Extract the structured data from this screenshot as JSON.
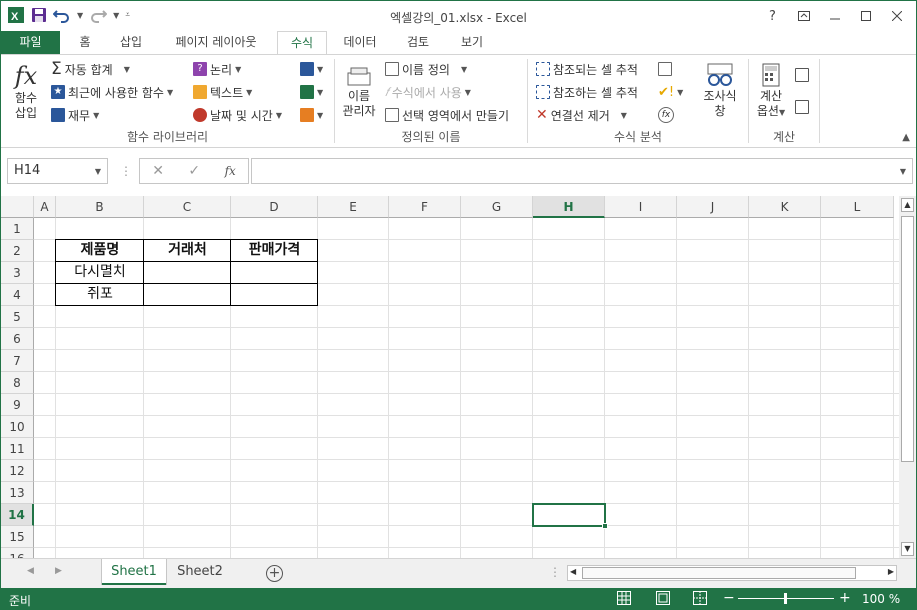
{
  "window": {
    "title": "엑셀강의_01.xlsx - Excel",
    "help": "?"
  },
  "tabs": [
    "파일",
    "홈",
    "삽입",
    "페이지 레이아웃",
    "수식",
    "데이터",
    "검토",
    "보기"
  ],
  "ribbon": {
    "insert_function": [
      "함수",
      "삽입"
    ],
    "autosum": "자동 합계",
    "recent": "최근에 사용한 함수",
    "financial": "재무",
    "logical": "논리",
    "text": "텍스트",
    "datetime": "날짜 및 시간",
    "group_library": "함수 라이브러리",
    "name_manager": [
      "이름",
      "관리자"
    ],
    "define_name": "이름 정의",
    "use_in_formula": "수식에서 사용",
    "create_from_selection": "선택 영역에서 만들기",
    "group_defined": "정의된 이름",
    "trace_precedents": "참조되는 셀 추적",
    "trace_dependents": "참조하는 셀 추적",
    "remove_arrows": "연결선 제거",
    "watch_window": [
      "조사식",
      "창"
    ],
    "group_audit": "수식 분석",
    "calc_options": [
      "계산",
      "옵션"
    ],
    "group_calc": "계산"
  },
  "formula_bar": {
    "name_box": "H14",
    "fx": "fx",
    "formula": ""
  },
  "columns": [
    "A",
    "B",
    "C",
    "D",
    "E",
    "F",
    "G",
    "H",
    "I",
    "J",
    "K",
    "L"
  ],
  "rows": [
    "1",
    "2",
    "3",
    "4",
    "5",
    "6",
    "7",
    "8",
    "9",
    "10",
    "11",
    "12",
    "13",
    "14",
    "15",
    "16"
  ],
  "cells": {
    "B2": "제품명",
    "C2": "거래처",
    "D2": "판매가격",
    "B3": "다시멸치",
    "B4": "쥐포"
  },
  "sheets": [
    "Sheet1",
    "Sheet2"
  ],
  "status": {
    "ready": "준비",
    "zoom": "100 %"
  },
  "colors": {
    "accent": "#217346"
  }
}
